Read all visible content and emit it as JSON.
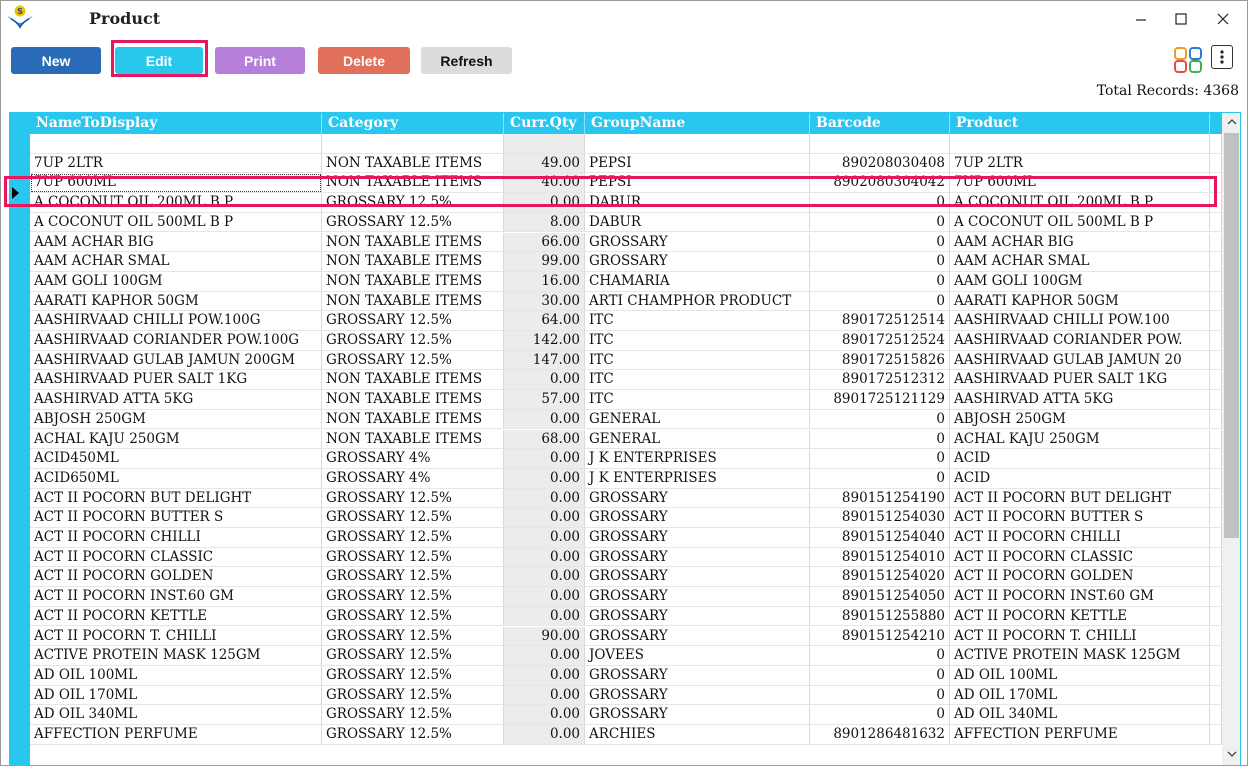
{
  "window": {
    "title": "Product"
  },
  "toolbar": {
    "new_label": "New",
    "edit_label": "Edit",
    "print_label": "Print",
    "delete_label": "Delete",
    "refresh_label": "Refresh"
  },
  "status": {
    "total_records": "Total Records: 4368"
  },
  "colors": {
    "accent": "#29c6ef",
    "highlight": "#e8175d",
    "new": "#2a6bb7",
    "print": "#b57ed8",
    "delete": "#e0705a"
  },
  "table": {
    "columns": [
      "NameToDisplay",
      "Category",
      "Curr.Qty",
      "GroupName",
      "Barcode",
      "Product"
    ],
    "rows": [
      [
        "7UP 2LTR",
        "NON TAXABLE ITEMS",
        "49.00",
        "PEPSI",
        "890208030408",
        "7UP 2LTR"
      ],
      [
        "7UP 600ML",
        "NON TAXABLE ITEMS",
        "40.00",
        "PEPSI",
        "8902080304042",
        "7UP 600ML"
      ],
      [
        "A COCONUT OIL 200ML B P",
        "GROSSARY 12.5%",
        "0.00",
        "DABUR",
        "0",
        "A COCONUT OIL 200ML B P"
      ],
      [
        "A COCONUT OIL 500ML B P",
        "GROSSARY 12.5%",
        "8.00",
        "DABUR",
        "0",
        "A COCONUT OIL 500ML B P"
      ],
      [
        "AAM ACHAR BIG",
        "NON TAXABLE ITEMS",
        "66.00",
        "GROSSARY",
        "0",
        "AAM ACHAR BIG"
      ],
      [
        "AAM ACHAR SMAL",
        "NON TAXABLE ITEMS",
        "99.00",
        "GROSSARY",
        "0",
        "AAM ACHAR SMAL"
      ],
      [
        "AAM GOLI 100GM",
        "NON TAXABLE ITEMS",
        "16.00",
        "CHAMARIA",
        "0",
        "AAM GOLI 100GM"
      ],
      [
        "AARATI KAPHOR 50GM",
        "NON TAXABLE ITEMS",
        "30.00",
        "ARTI CHAMPHOR PRODUCT",
        "0",
        "AARATI KAPHOR 50GM"
      ],
      [
        "AASHIRVAAD CHILLI POW.100G",
        "GROSSARY 12.5%",
        "64.00",
        "ITC",
        "890172512514",
        "AASHIRVAAD CHILLI POW.100"
      ],
      [
        "AASHIRVAAD CORIANDER POW.100G",
        "GROSSARY 12.5%",
        "142.00",
        "ITC",
        "890172512524",
        "AASHIRVAAD CORIANDER POW."
      ],
      [
        "AASHIRVAAD GULAB JAMUN 200GM",
        "GROSSARY 12.5%",
        "147.00",
        "ITC",
        "890172515826",
        "AASHIRVAAD GULAB JAMUN 20"
      ],
      [
        "AASHIRVAAD PUER SALT 1KG",
        "NON TAXABLE ITEMS",
        "0.00",
        "ITC",
        "890172512312",
        "AASHIRVAAD PUER SALT 1KG"
      ],
      [
        "AASHIRVAD ATTA 5KG",
        "NON TAXABLE ITEMS",
        "57.00",
        "ITC",
        "8901725121129",
        "AASHIRVAD ATTA 5KG"
      ],
      [
        "ABJOSH 250GM",
        "NON TAXABLE ITEMS",
        "0.00",
        "GENERAL",
        "0",
        "ABJOSH 250GM"
      ],
      [
        "ACHAL KAJU 250GM",
        "NON TAXABLE ITEMS",
        "68.00",
        "GENERAL",
        "0",
        "ACHAL KAJU 250GM"
      ],
      [
        "ACID450ML",
        "GROSSARY 4%",
        "0.00",
        "J K ENTERPRISES",
        "0",
        "ACID"
      ],
      [
        "ACID650ML",
        "GROSSARY 4%",
        "0.00",
        "J K ENTERPRISES",
        "0",
        "ACID"
      ],
      [
        "ACT II POCORN BUT DELIGHT",
        "GROSSARY 12.5%",
        "0.00",
        "GROSSARY",
        "890151254190",
        "ACT II POCORN BUT DELIGHT"
      ],
      [
        "ACT II POCORN BUTTER S",
        "GROSSARY 12.5%",
        "0.00",
        "GROSSARY",
        "890151254030",
        "ACT II POCORN BUTTER S"
      ],
      [
        "ACT II POCORN CHILLI",
        "GROSSARY 12.5%",
        "0.00",
        "GROSSARY",
        "890151254040",
        "ACT II POCORN CHILLI"
      ],
      [
        "ACT II POCORN CLASSIC",
        "GROSSARY 12.5%",
        "0.00",
        "GROSSARY",
        "890151254010",
        "ACT II POCORN CLASSIC"
      ],
      [
        "ACT II POCORN GOLDEN",
        "GROSSARY 12.5%",
        "0.00",
        "GROSSARY",
        "890151254020",
        "ACT II POCORN GOLDEN"
      ],
      [
        "ACT II POCORN INST.60 GM",
        "GROSSARY 12.5%",
        "0.00",
        "GROSSARY",
        "890151254050",
        "ACT II POCORN INST.60 GM"
      ],
      [
        "ACT II POCORN KETTLE",
        "GROSSARY 12.5%",
        "0.00",
        "GROSSARY",
        "890151255880",
        "ACT II POCORN KETTLE"
      ],
      [
        "ACT II POCORN T. CHILLI",
        "GROSSARY 12.5%",
        "90.00",
        "GROSSARY",
        "890151254210",
        "ACT II POCORN T. CHILLI"
      ],
      [
        "ACTIVE PROTEIN MASK 125GM",
        "GROSSARY 12.5%",
        "0.00",
        "JOVEES",
        "0",
        "ACTIVE PROTEIN MASK 125GM"
      ],
      [
        "AD OIL 100ML",
        "GROSSARY 12.5%",
        "0.00",
        "GROSSARY",
        "0",
        "AD OIL 100ML"
      ],
      [
        "AD OIL 170ML",
        "GROSSARY 12.5%",
        "0.00",
        "GROSSARY",
        "0",
        "AD OIL 170ML"
      ],
      [
        "AD OIL 340ML",
        "GROSSARY 12.5%",
        "0.00",
        "GROSSARY",
        "0",
        "AD OIL 340ML"
      ],
      [
        "AFFECTION PERFUME",
        "GROSSARY 12.5%",
        "0.00",
        "ARCHIES",
        "8901286481632",
        "AFFECTION PERFUME"
      ]
    ],
    "selected_row_index": 1
  }
}
